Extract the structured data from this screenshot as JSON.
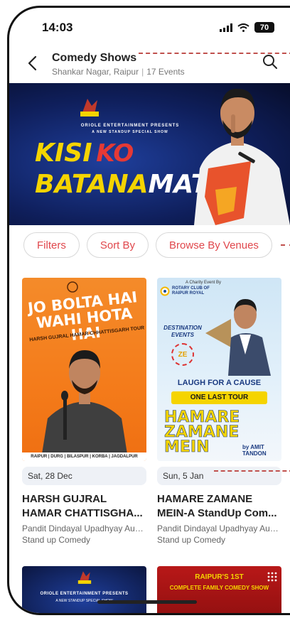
{
  "status_bar": {
    "time": "14:03",
    "battery": "70"
  },
  "header": {
    "title": "Comedy Shows",
    "location": "Shankar Nagar, Raipur",
    "event_count": "17 Events"
  },
  "banner": {
    "brand": "ORIOLE ENTERTAINMENT PRESENTS",
    "subtitle": "A NEW STANDUP SPECIAL SHOW",
    "title_word1": "KISI",
    "title_word2": "KO",
    "title_word3": "BATANA",
    "title_word4": "MAT"
  },
  "chips": [
    {
      "label": "Filters"
    },
    {
      "label": "Sort By"
    },
    {
      "label": "Browse By Venues"
    }
  ],
  "events": [
    {
      "poster_heading1": "JO BOLTA HAI",
      "poster_heading2": "WAHI HOTA HAI",
      "poster_sub": "HARSH GUJRAL HAMAR CHHATTISGARH TOUR",
      "poster_cities": "RAIPUR | DURG | BILASPUR | KORBA | JAGDALPUR",
      "date": "Sat, 28 Dec",
      "title": "HARSH GUJRAL HAMAR CHATTISGHA...",
      "venue": "Pandit Dindayal Upadhyay Aud...",
      "category": "Stand up Comedy"
    },
    {
      "poster_top": "A Charity Event By",
      "poster_rotary": "ROTARY CLUB OF RAIPUR ROYAL",
      "poster_dest": "DESTINATION EVENTS",
      "poster_laugh": "LAUGH FOR A CAUSE",
      "poster_tour": "ONE LAST TOUR",
      "poster_big1": "HAMARE",
      "poster_big2": "ZAMANE",
      "poster_big3": "MEIN",
      "poster_by": "by AMIT TANDON",
      "date": "Sun, 5 Jan",
      "title": "HAMARE ZAMANE MEIN-A StandUp Com...",
      "venue": "Pandit Dindayal Upadhyay Aud...",
      "category": "Stand up Comedy"
    }
  ],
  "bottom_posters": [
    {
      "brand": "ORIOLE ENTERTAINMENT PRESENTS",
      "subtitle": "A NEW STANDUP SPECIAL SHOW"
    },
    {
      "heading1": "RAIPUR'S 1ST",
      "heading2": "COMPLETE FAMILY COMEDY SHOW"
    }
  ],
  "colors": {
    "accent": "#e0474c",
    "banner_bg": "#0f1f5c",
    "poster1_bg": "#f47b1a",
    "poster2_bg": "#e2f0fa"
  },
  "icons": {
    "back": "chevron-left-icon",
    "search": "search-icon",
    "more": "dots-grid-icon"
  }
}
